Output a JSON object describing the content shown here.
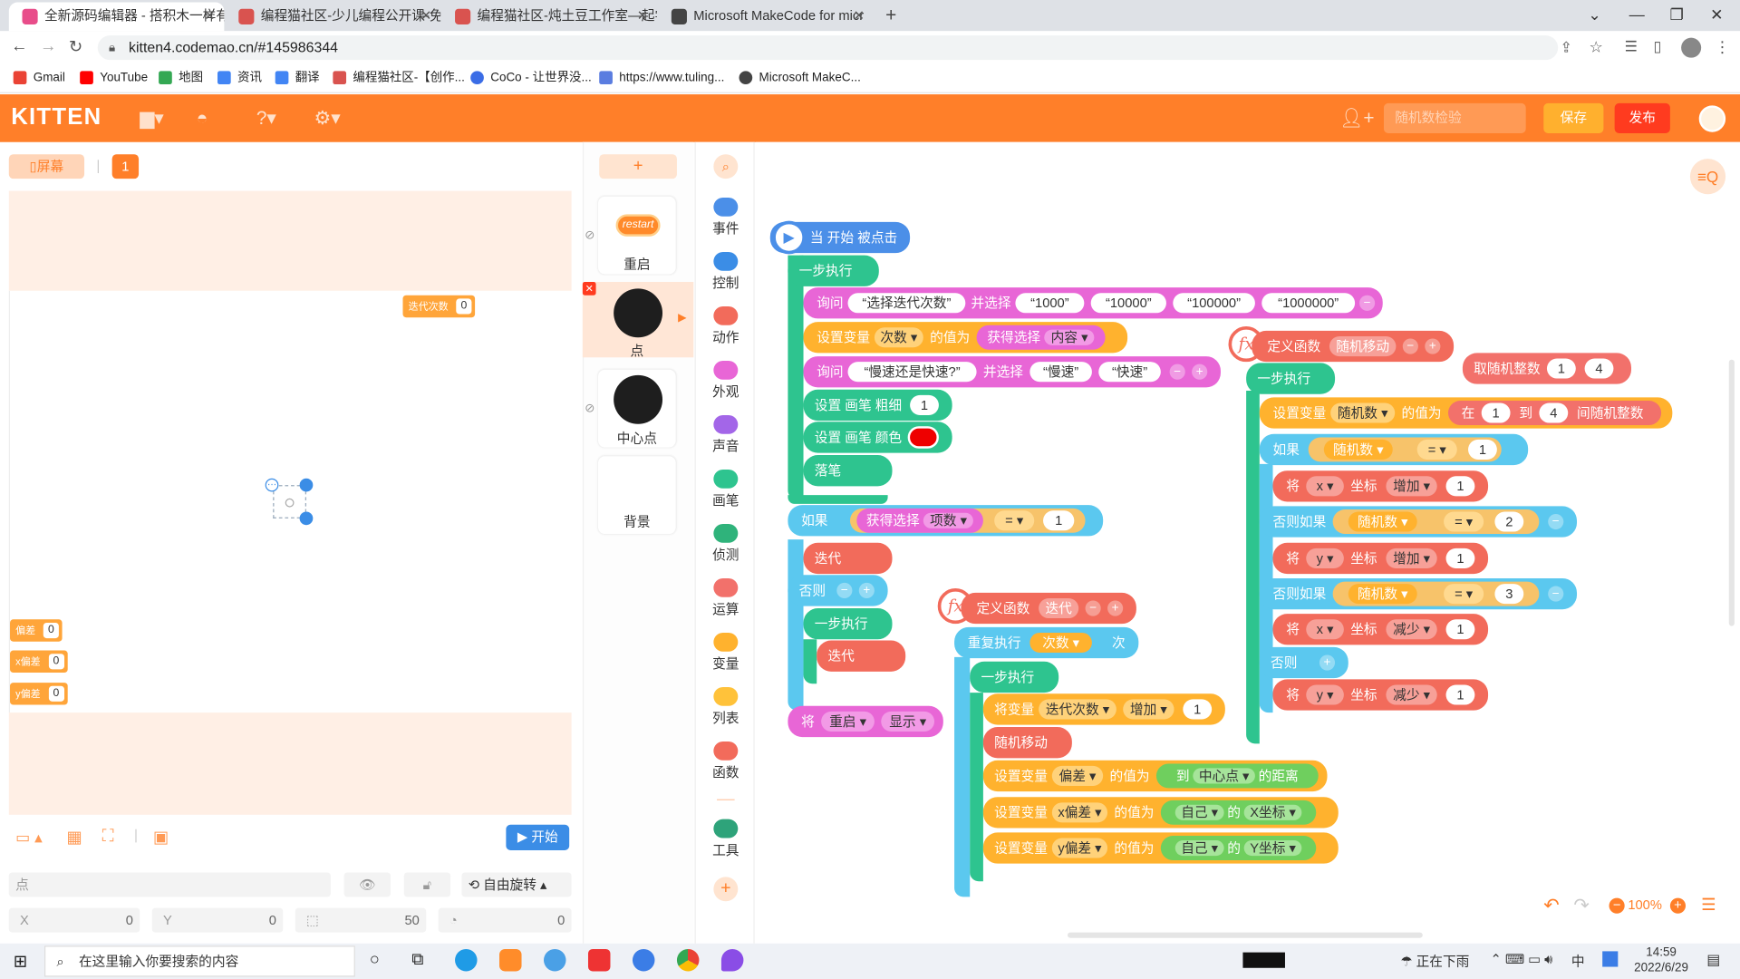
{
  "browser": {
    "tabs": [
      {
        "title": "全新源码编辑器 - 搭积木一样有趣",
        "color": "#e84d8a"
      },
      {
        "title": "编程猫社区-少儿编程公开课-免费",
        "color": "#d9534f"
      },
      {
        "title": "编程猫社区-炖土豆工作室—起学",
        "color": "#d9534f"
      },
      {
        "title": "Microsoft MakeCode for micr",
        "color": "#444444"
      }
    ],
    "new_tab": "+",
    "url": "kitten4.codemao.cn/#145986344",
    "bookmarks": [
      "Gmail",
      "YouTube",
      "地图",
      "资讯",
      "翻译",
      "编程猫社区-【创作...",
      "CoCo - 让世界没...",
      "https://www.tuling...",
      "Microsoft MakeC..."
    ]
  },
  "header": {
    "logo": "KITTEN",
    "project_name_placeholder": "随机数检验",
    "save": "保存",
    "publish": "发布"
  },
  "stage": {
    "screen_button": "▯屏幕",
    "screen_index": "1",
    "vars": [
      {
        "label": "迭代次数",
        "value": "0"
      },
      {
        "label": "偏差",
        "value": "0"
      },
      {
        "label": "x偏差",
        "value": "0"
      },
      {
        "label": "y偏差",
        "value": "0"
      }
    ],
    "start_button": "▶ 开始",
    "sprite_name": "点",
    "rotation": "自由旋转",
    "x_label": "X",
    "x_value": "0",
    "y_label": "Y",
    "y_value": "0",
    "size_value": "50",
    "dir_value": "0"
  },
  "sprites": {
    "add": "+",
    "items": [
      {
        "label": "重启",
        "art": "restart"
      },
      {
        "label": "点",
        "art": ""
      },
      {
        "label": "中心点",
        "art": ""
      },
      {
        "label": "背景",
        "art": ""
      }
    ]
  },
  "categories": [
    {
      "label": "事件",
      "color": "#4b8fe8"
    },
    {
      "label": "控制",
      "color": "#3b8de6"
    },
    {
      "label": "动作",
      "color": "#f26b5b"
    },
    {
      "label": "外观",
      "color": "#e866d6"
    },
    {
      "label": "声音",
      "color": "#a366e8"
    },
    {
      "label": "画笔",
      "color": "#2ec48f"
    },
    {
      "label": "侦测",
      "color": "#2fb37b"
    },
    {
      "label": "运算",
      "color": "#f2716b"
    },
    {
      "label": "变量",
      "color": "#ffb22e"
    },
    {
      "label": "列表",
      "color": "#ffc23a"
    },
    {
      "label": "函数",
      "color": "#f26b5b"
    },
    {
      "label": "工具",
      "color": "#2ea37a"
    }
  ],
  "blocks": {
    "hat": "当 开始 被点击",
    "step": "一步执行",
    "ask1": "询问",
    "ask1_q": "“选择迭代次数”",
    "and_choose": "并选择",
    "opts1": [
      "“1000”",
      "“10000”",
      "“100000”",
      "“1000000”"
    ],
    "setvar": "设置变量",
    "var_times": "次数",
    "value_of": "的值为",
    "get_choice": "获得选择",
    "content": "内容",
    "ask2_q": "“慢速还是快速?”",
    "opts2": [
      "“慢速”",
      "“快速”"
    ],
    "pen_size": "设置 画笔 粗细",
    "pen_size_v": "1",
    "pen_color": "设置 画笔 颜色",
    "pen_down": "落笔",
    "if": "如果",
    "item_no": "项数",
    "eq": "=",
    "one": "1",
    "iterate": "迭代",
    "else": "否则",
    "set": "将",
    "restart": "重启",
    "show": "显示",
    "def": "定义函数",
    "f_iter": "迭代",
    "repeat": "重复执行",
    "times_suffix": "次",
    "setvar2": "将变量",
    "iter_count": "迭代次数",
    "increase": "增加",
    "rand_move": "随机移动",
    "dev": "偏差",
    "to": "到",
    "center": "中心点",
    "distance": "的距离",
    "xdev": "x偏差",
    "ydev": "y偏差",
    "self": "自己",
    "of": "的",
    "xcoord": "X坐标",
    "ycoord": "Y坐标",
    "rand_int": "取随机整数",
    "r1": "1",
    "r4": "4",
    "randvar": "随机数",
    "in": "在",
    "to2": "到",
    "between": "间随机整数",
    "x": "x",
    "y": "y",
    "coord": "坐标",
    "decrease": "减少",
    "elseif": "否则如果",
    "two": "2",
    "three": "3"
  },
  "zoom": {
    "level": "100%"
  },
  "taskbar": {
    "search": "在这里输入你要搜索的内容",
    "weather": "正在下雨",
    "time": "14:59",
    "date": "2022/6/29",
    "lang": "中"
  },
  "colors": {
    "orange": "#ff7f29",
    "event": "#4b8fe8",
    "look": "#e866d6",
    "var": "#ffb22e",
    "pen": "#2ec48f",
    "control": "#5bc8ef",
    "func": "#f26b5b",
    "sense": "#6fcf5e"
  }
}
